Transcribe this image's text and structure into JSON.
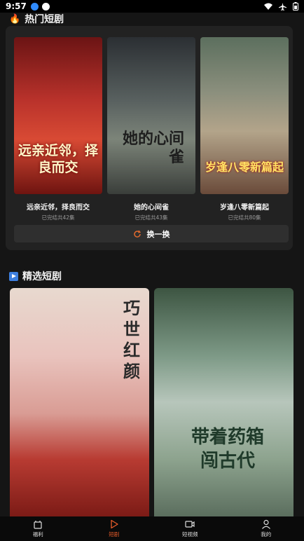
{
  "status_bar": {
    "time": "9:57"
  },
  "hot_section": {
    "title": "热门短剧",
    "icon": "fire-icon",
    "dramas": [
      {
        "poster_title": "远亲近邻，择良而交",
        "title": "远亲近邻，择良而交",
        "subtitle": "已完结共42集"
      },
      {
        "poster_title": "她的心间雀",
        "title": "她的心间雀",
        "subtitle": "已完结共43集"
      },
      {
        "poster_title": "岁逢八零新篇起",
        "title": "岁逢八零新篇起",
        "subtitle": "已完结共80集"
      }
    ],
    "refresh_label": "换一换"
  },
  "featured_section": {
    "title": "精选短剧",
    "icon": "play-square-icon",
    "items": [
      {
        "poster_title": "巧世红颜"
      },
      {
        "poster_title": "带着药箱闯古代"
      }
    ]
  },
  "bottom_nav": {
    "items": [
      {
        "label": "福利",
        "icon": "gift-icon",
        "active": false
      },
      {
        "label": "短剧",
        "icon": "play-icon",
        "active": true
      },
      {
        "label": "短视频",
        "icon": "video-camera-icon",
        "active": false
      },
      {
        "label": "我的",
        "icon": "user-icon",
        "active": false
      }
    ]
  },
  "colors": {
    "accent": "#e85c2a",
    "background": "#151515",
    "card": "#222222"
  }
}
